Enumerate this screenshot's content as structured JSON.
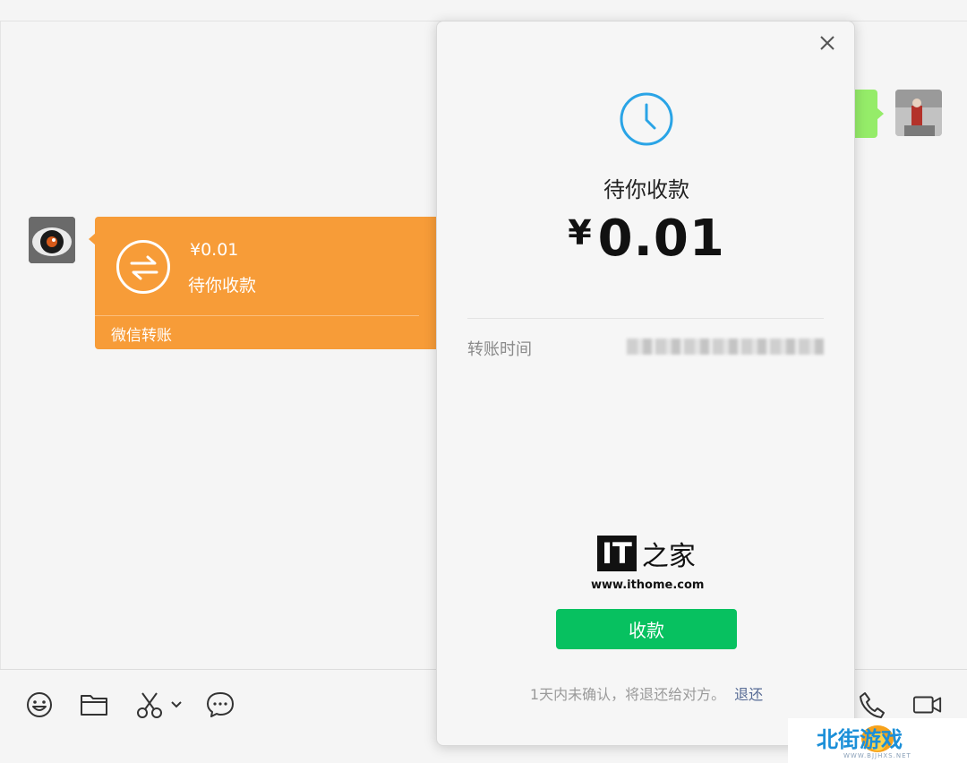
{
  "chat": {
    "transfer_card": {
      "amount": "¥0.01",
      "status": "待你收款",
      "footer": "微信转账"
    }
  },
  "modal": {
    "status": "待你收款",
    "currency": "¥",
    "amount": "0.01",
    "time_label": "转账时间",
    "receive_label": "收款",
    "notice": "1天内未确认，将退还给对方。",
    "refund_label": "退还"
  },
  "watermark": {
    "brand": "IT",
    "brand_suffix": "之家",
    "url": "www.ithome.com"
  },
  "site_badge": {
    "name": "北街游戏",
    "url": "WWW.BJJHXS.NET"
  },
  "colors": {
    "accent_green": "#07c160",
    "transfer_orange": "#f79c38",
    "link_blue": "#576b95",
    "clock_blue": "#2aa4e6"
  },
  "icons": [
    "close-icon",
    "clock-icon",
    "transfer-arrows-icon",
    "emoji-icon",
    "folder-icon",
    "scissors-icon",
    "chevron-down-icon",
    "chat-bubble-icon",
    "phone-icon",
    "video-icon"
  ]
}
